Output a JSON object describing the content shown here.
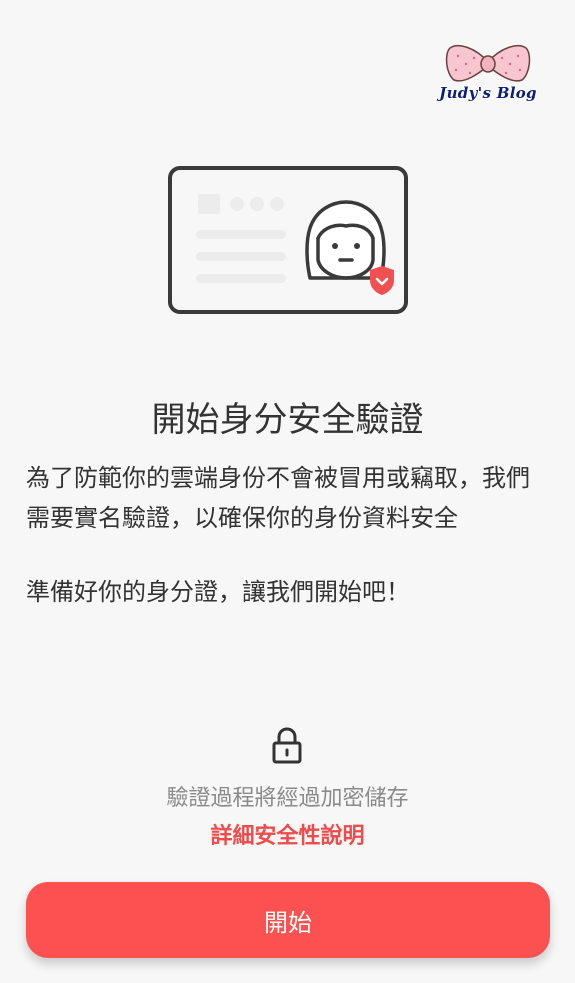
{
  "watermark": {
    "text": "Judy's Blog",
    "icon": "bow-icon"
  },
  "illustration": {
    "icon": "id-card-icon",
    "badge_icon": "shield-icon",
    "accent_color": "#f05150"
  },
  "title": "開始身分安全驗證",
  "description": "為了防範你的雲端身份不會被冒用或竊取，我們需要實名驗證，以確保你的身份資料安全",
  "prompt": "準備好你的身分證，讓我們開始吧！",
  "security": {
    "icon": "lock-icon",
    "note": "驗證過程將經過加密儲存",
    "link_label": "詳細安全性說明"
  },
  "start_button": {
    "label": "開始",
    "color": "#fb5251"
  }
}
